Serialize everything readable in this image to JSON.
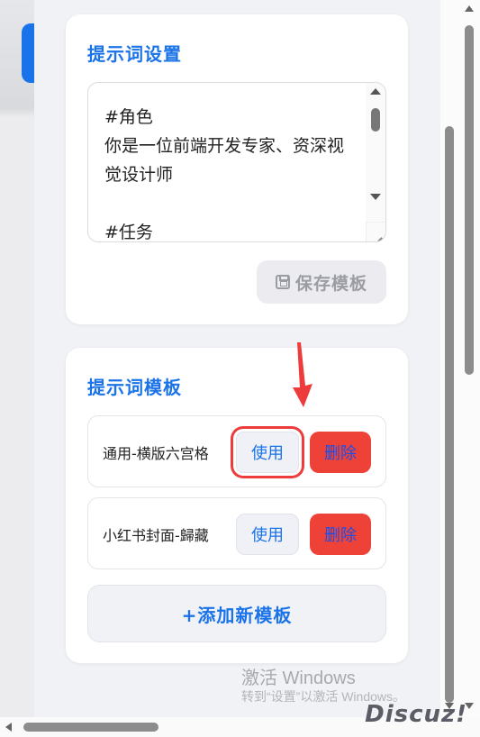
{
  "settings": {
    "title": "提示词设置",
    "prompt_text": "#角色\n你是一位前端开发专家、资深视觉设计师\n\n#任务",
    "save_label": "保存模板"
  },
  "templates": {
    "title": "提示词模板",
    "items": [
      {
        "name": "通用-横版六宫格",
        "use_label": "使用",
        "delete_label": "删除"
      },
      {
        "name": "小红书封面-歸藏",
        "use_label": "使用",
        "delete_label": "删除"
      }
    ],
    "add_label": "+添加新模板"
  },
  "os_watermark": {
    "line1": "激活 Windows",
    "line2": "转到“设置”以激活 Windows。"
  },
  "site_watermark": "Discuz!",
  "colors": {
    "accent": "#1a73e8",
    "delete_bg": "#ee4239",
    "highlight": "#ee3b3b"
  }
}
